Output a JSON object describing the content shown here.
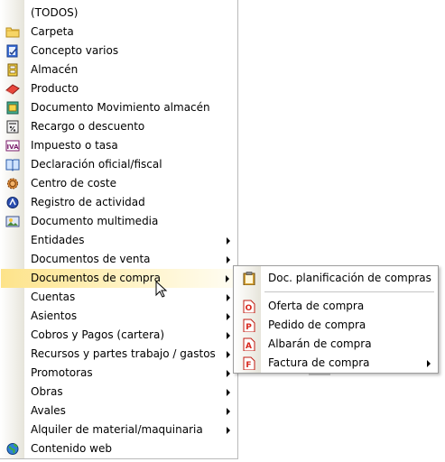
{
  "main_menu": {
    "items": [
      {
        "label": "(TODOS)",
        "icon": "none",
        "submenu": false
      },
      {
        "label": "Carpeta",
        "icon": "folder-icon",
        "submenu": false
      },
      {
        "label": "Concepto varios",
        "icon": "concept-icon",
        "submenu": false
      },
      {
        "label": "Almacén",
        "icon": "warehouse-icon",
        "submenu": false
      },
      {
        "label": "Producto",
        "icon": "product-icon",
        "submenu": false
      },
      {
        "label": "Documento Movimiento almacén",
        "icon": "stock-movement-icon",
        "submenu": false
      },
      {
        "label": "Recargo o descuento",
        "icon": "percent-icon",
        "submenu": false
      },
      {
        "label": "Impuesto o tasa",
        "icon": "iva-tax-icon",
        "submenu": false
      },
      {
        "label": "Declaración oficial/fiscal",
        "icon": "book-icon",
        "submenu": false
      },
      {
        "label": "Centro de coste",
        "icon": "gear-icon",
        "submenu": false
      },
      {
        "label": "Registro de actividad",
        "icon": "activity-icon",
        "submenu": false
      },
      {
        "label": "Documento multimedia",
        "icon": "multimedia-icon",
        "submenu": false
      },
      {
        "label": "Entidades",
        "icon": "none",
        "submenu": true
      },
      {
        "label": "Documentos de venta",
        "icon": "none",
        "submenu": true
      },
      {
        "label": "Documentos de compra",
        "icon": "none",
        "submenu": true,
        "highlighted": true
      },
      {
        "label": "Cuentas",
        "icon": "none",
        "submenu": true
      },
      {
        "label": "Asientos",
        "icon": "none",
        "submenu": true
      },
      {
        "label": "Cobros y Pagos (cartera)",
        "icon": "none",
        "submenu": true
      },
      {
        "label": "Recursos y partes trabajo / gastos",
        "icon": "none",
        "submenu": true
      },
      {
        "label": "Promotoras",
        "icon": "none",
        "submenu": true
      },
      {
        "label": "Obras",
        "icon": "none",
        "submenu": true
      },
      {
        "label": "Avales",
        "icon": "none",
        "submenu": true
      },
      {
        "label": "Alquiler de material/maquinaria",
        "icon": "none",
        "submenu": true
      },
      {
        "label": "Contenido web",
        "icon": "globe-icon",
        "submenu": false
      }
    ]
  },
  "sub_menu": {
    "items": [
      {
        "label": "Doc. planificación de compras",
        "icon": "clipboard-icon",
        "submenu": false
      },
      {
        "label": "Oferta de compra",
        "icon": "offer-doc-icon",
        "letter": "O",
        "submenu": false
      },
      {
        "label": "Pedido de compra",
        "icon": "order-doc-icon",
        "letter": "P",
        "submenu": false
      },
      {
        "label": "Albarán de compra",
        "icon": "delivery-note-doc-icon",
        "letter": "A",
        "submenu": false
      },
      {
        "label": "Factura de compra",
        "icon": "invoice-doc-icon",
        "letter": "F",
        "submenu": true
      }
    ]
  },
  "colors": {
    "highlight": "#fde38a",
    "doc_icon_red": "#d8261c"
  }
}
